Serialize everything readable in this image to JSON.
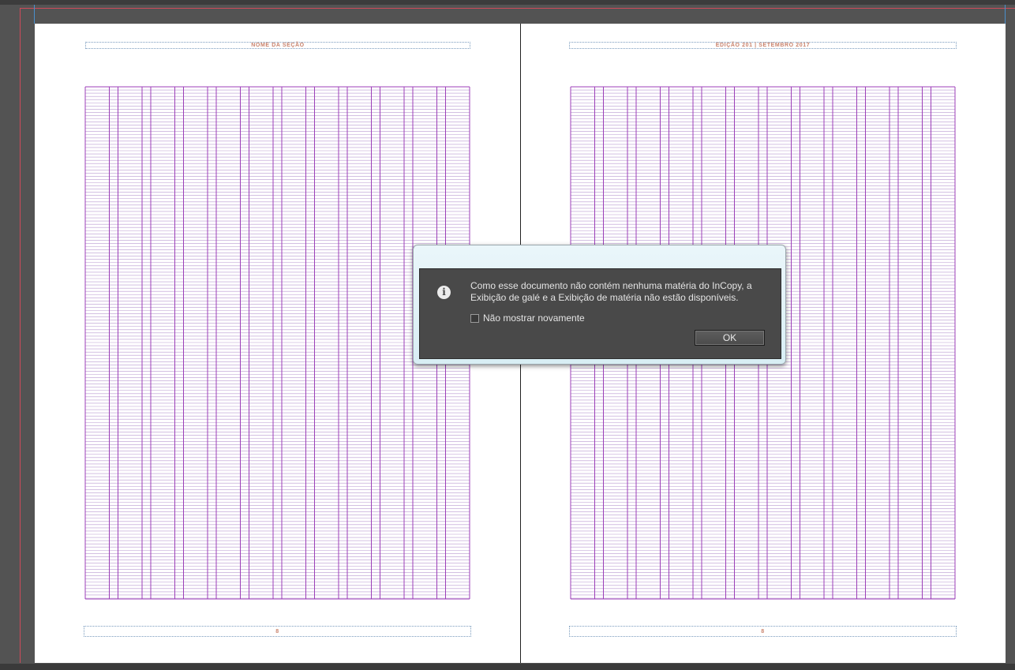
{
  "document": {
    "left_page": {
      "header": "NOME DA SEÇÃO",
      "folio": "8"
    },
    "right_page": {
      "header": "EDIÇÃO 201 | SETEMBRO 2017",
      "folio": "8"
    },
    "grid_color": "#9c3fb8",
    "guide_color": "#d04a5a"
  },
  "dialog": {
    "message_line1": "Como esse documento não contém nenhuma matéria do InCopy, a",
    "message_line2": "Exibição de galé e a Exibição de matéria não estão disponíveis.",
    "checkbox_label": "Não mostrar novamente",
    "checkbox_checked": false,
    "ok_label": "OK",
    "icon": "info-icon"
  }
}
